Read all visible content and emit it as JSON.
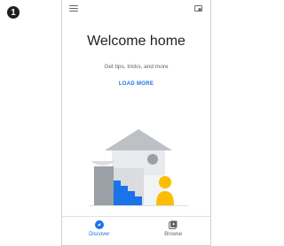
{
  "step": {
    "number": "1"
  },
  "header": {
    "menu_icon": "hamburger-menu-icon",
    "cast_icon": "cast-icon"
  },
  "main": {
    "title": "Welcome home",
    "subtitle": "Get tips, tricks, and more",
    "load_more_label": "LOAD MORE"
  },
  "bottom_nav": {
    "items": [
      {
        "label": "Discover",
        "icon": "compass-icon",
        "active": true
      },
      {
        "label": "Browse",
        "icon": "browse-icon",
        "active": false
      }
    ]
  },
  "colors": {
    "accent": "#1a73e8",
    "text_primary": "#202124",
    "text_secondary": "#5f6368"
  }
}
